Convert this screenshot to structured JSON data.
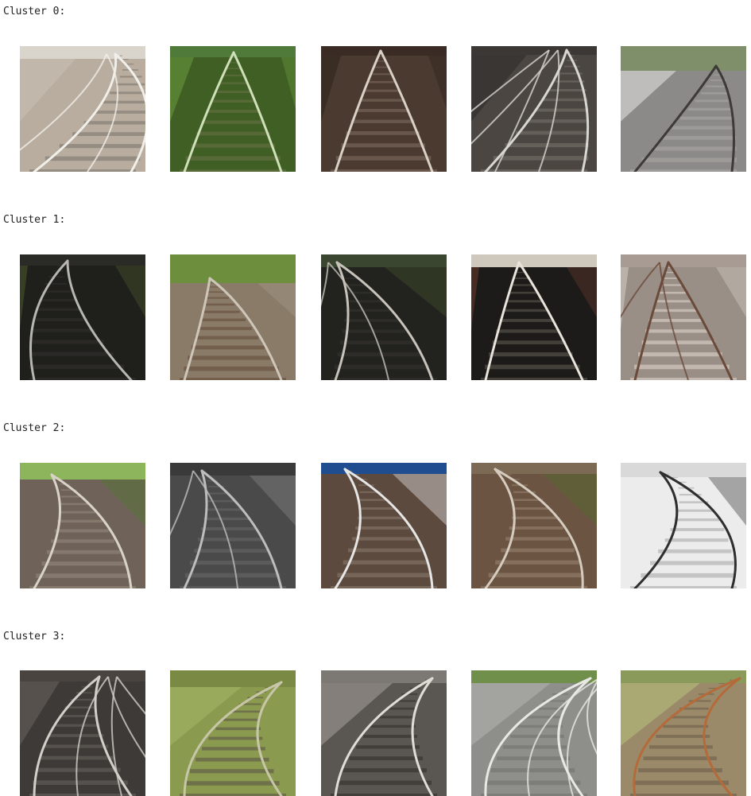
{
  "clusters": [
    {
      "label": "Cluster 0:",
      "images": [
        {
          "scene": "light-gravel-curve",
          "sky": "#d9d4cc",
          "ground": "#b8ad9f",
          "rail": "#f1efe9",
          "tie": "#8f877c",
          "accent": "#c9c1b5"
        },
        {
          "scene": "green-straight",
          "sky": "#4f7a3a",
          "ground": "#3f5f24",
          "rail": "#cfe0b8",
          "tie": "#5b6b3a",
          "accent": "#6e9a3f"
        },
        {
          "scene": "dark-straight",
          "sky": "#3a2c24",
          "ground": "#4a3a30",
          "rail": "#d9d0c6",
          "tie": "#6f5d50",
          "accent": "#2e231c"
        },
        {
          "scene": "dark-switches",
          "sky": "#3b3835",
          "ground": "#4b4642",
          "rail": "#d8d6d2",
          "tie": "#6a645e",
          "accent": "#2c2a28"
        },
        {
          "scene": "platform-gray",
          "sky": "#7f8f6a",
          "ground": "#8c8a88",
          "rail": "#3d3a38",
          "tie": "#a09e9b",
          "accent": "#e8e8e8"
        }
      ]
    },
    {
      "label": "Cluster 1:",
      "images": [
        {
          "scene": "dark-curve-left",
          "sky": "#2a2a26",
          "ground": "#1f1f1c",
          "rail": "#b8b6b0",
          "tie": "#2d2c28",
          "accent": "#4a5a2e"
        },
        {
          "scene": "crossing-green",
          "sky": "#6d8f3d",
          "ground": "#8a7a68",
          "rail": "#cfc6ba",
          "tie": "#6f5a48",
          "accent": "#a59a8c"
        },
        {
          "scene": "dark-diverge",
          "sky": "#3a4630",
          "ground": "#22221f",
          "rail": "#c7c2ba",
          "tie": "#2f2e2a",
          "accent": "#46552e"
        },
        {
          "scene": "platform-dark",
          "sky": "#cfc9bd",
          "ground": "#1c1b19",
          "rail": "#e8e4dc",
          "tie": "#4a4540",
          "accent": "#6b3a2e"
        },
        {
          "scene": "bright-straight",
          "sky": "#a79b93",
          "ground": "#9a8f86",
          "rail": "#6a4a3a",
          "tie": "#c9c0b6",
          "accent": "#d5cec7"
        }
      ]
    },
    {
      "label": "Cluster 2:",
      "images": [
        {
          "scene": "green-curve-right",
          "sky": "#8db65c",
          "ground": "#6f6258",
          "rail": "#d8d2c8",
          "tie": "#8a7e72",
          "accent": "#4d7d2f"
        },
        {
          "scene": "gray-bridge",
          "sky": "#3a3a3a",
          "ground": "#4a4a4a",
          "rail": "#bdbdbd",
          "tie": "#5e5e5e",
          "accent": "#8a8a8a"
        },
        {
          "scene": "blue-snow-curve",
          "sky": "#1f4d8f",
          "ground": "#5d4a3e",
          "rail": "#e6e6e6",
          "tie": "#7a6a5e",
          "accent": "#f2f2f2"
        },
        {
          "scene": "brown-curve-right",
          "sky": "#7d6a55",
          "ground": "#6b5442",
          "rail": "#d5cbbf",
          "tie": "#8a7461",
          "accent": "#4f6f2b"
        },
        {
          "scene": "snow-bw",
          "sky": "#d9d9d9",
          "ground": "#ececec",
          "rail": "#2f2f2f",
          "tie": "#bdbdbd",
          "accent": "#3a3a3a"
        }
      ]
    },
    {
      "label": "Cluster 3:",
      "images": [
        {
          "scene": "dark-multi-curve",
          "sky": "#4a4440",
          "ground": "#3e3a37",
          "rail": "#d2cec8",
          "tie": "#5c5651",
          "accent": "#6a645e"
        },
        {
          "scene": "grass-curve",
          "sky": "#7a8a44",
          "ground": "#8a9a4e",
          "rail": "#c8c6a8",
          "tie": "#6a6a4a",
          "accent": "#a6b86a"
        },
        {
          "scene": "platform-curve",
          "sky": "#7c7873",
          "ground": "#5a5652",
          "rail": "#e0dcd6",
          "tie": "#3e3a36",
          "accent": "#a8a39d"
        },
        {
          "scene": "tram-curves",
          "sky": "#6f8f4a",
          "ground": "#8e8e8a",
          "rail": "#e8e8e4",
          "tie": "#7a7a76",
          "accent": "#b5b5b0"
        },
        {
          "scene": "rust-curve",
          "sky": "#8a9a5a",
          "ground": "#9a8a6a",
          "rail": "#b56a3a",
          "tie": "#7a6a52",
          "accent": "#b8c27a"
        }
      ]
    }
  ]
}
